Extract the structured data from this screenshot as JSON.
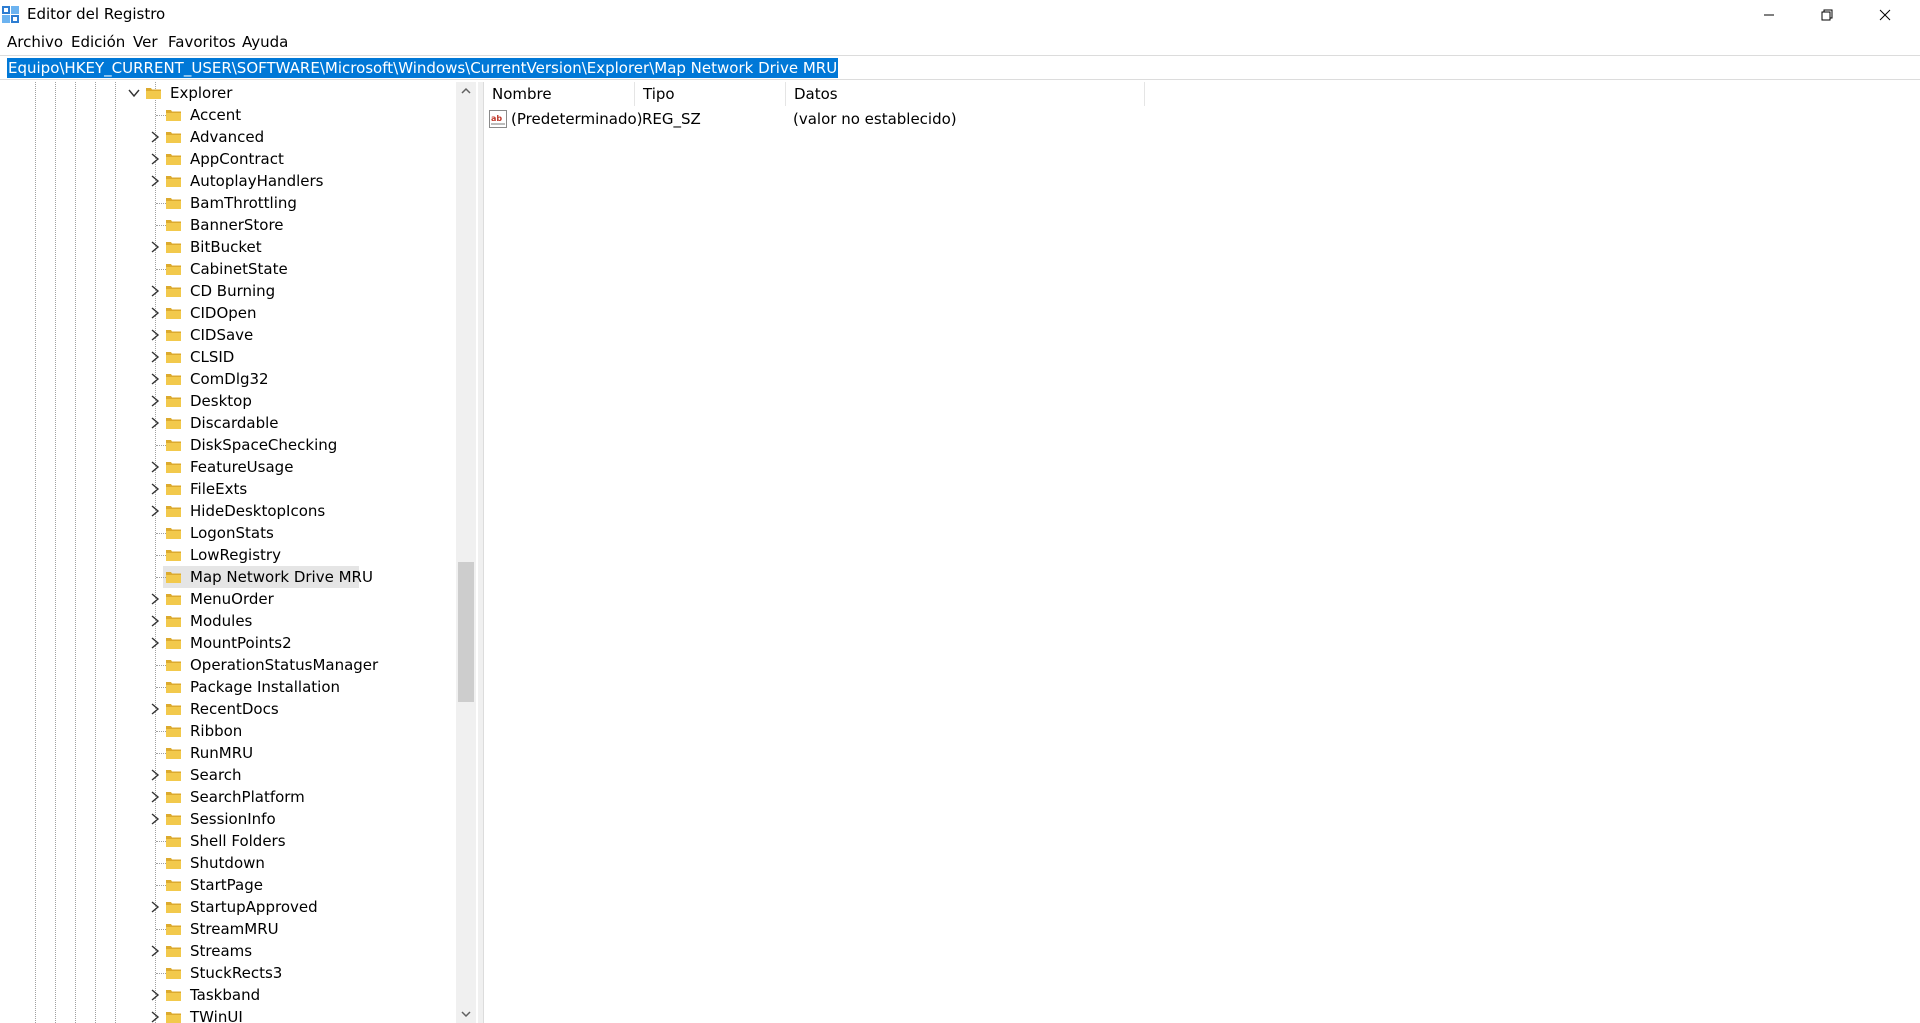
{
  "window": {
    "title": "Editor del Registro",
    "minimize_glyph": "─",
    "maximize_glyph": "❐",
    "close_glyph": "✕"
  },
  "menu": [
    "Archivo",
    "Edición",
    "Ver",
    "Favoritos",
    "Ayuda"
  ],
  "address": {
    "path": "Equipo\\HKEY_CURRENT_USER\\SOFTWARE\\Microsoft\\Windows\\CurrentVersion\\Explorer\\Map Network Drive MRU"
  },
  "tree": {
    "parent": {
      "label": "Explorer",
      "expanded": true
    },
    "children": [
      {
        "label": "Accent",
        "expandable": false
      },
      {
        "label": "Advanced",
        "expandable": true
      },
      {
        "label": "AppContract",
        "expandable": true
      },
      {
        "label": "AutoplayHandlers",
        "expandable": true
      },
      {
        "label": "BamThrottling",
        "expandable": false
      },
      {
        "label": "BannerStore",
        "expandable": false
      },
      {
        "label": "BitBucket",
        "expandable": true
      },
      {
        "label": "CabinetState",
        "expandable": false
      },
      {
        "label": "CD Burning",
        "expandable": true
      },
      {
        "label": "CIDOpen",
        "expandable": true
      },
      {
        "label": "CIDSave",
        "expandable": true
      },
      {
        "label": "CLSID",
        "expandable": true
      },
      {
        "label": "ComDlg32",
        "expandable": true
      },
      {
        "label": "Desktop",
        "expandable": true
      },
      {
        "label": "Discardable",
        "expandable": true
      },
      {
        "label": "DiskSpaceChecking",
        "expandable": false
      },
      {
        "label": "FeatureUsage",
        "expandable": true
      },
      {
        "label": "FileExts",
        "expandable": true
      },
      {
        "label": "HideDesktopIcons",
        "expandable": true
      },
      {
        "label": "LogonStats",
        "expandable": false
      },
      {
        "label": "LowRegistry",
        "expandable": false
      },
      {
        "label": "Map Network Drive MRU",
        "expandable": false,
        "selected": true
      },
      {
        "label": "MenuOrder",
        "expandable": true
      },
      {
        "label": "Modules",
        "expandable": true
      },
      {
        "label": "MountPoints2",
        "expandable": true
      },
      {
        "label": "OperationStatusManager",
        "expandable": false
      },
      {
        "label": "Package Installation",
        "expandable": false
      },
      {
        "label": "RecentDocs",
        "expandable": true
      },
      {
        "label": "Ribbon",
        "expandable": false
      },
      {
        "label": "RunMRU",
        "expandable": false
      },
      {
        "label": "Search",
        "expandable": true
      },
      {
        "label": "SearchPlatform",
        "expandable": true
      },
      {
        "label": "SessionInfo",
        "expandable": true
      },
      {
        "label": "Shell Folders",
        "expandable": false
      },
      {
        "label": "Shutdown",
        "expandable": false
      },
      {
        "label": "StartPage",
        "expandable": false
      },
      {
        "label": "StartupApproved",
        "expandable": true
      },
      {
        "label": "StreamMRU",
        "expandable": false
      },
      {
        "label": "Streams",
        "expandable": true
      },
      {
        "label": "StuckRects3",
        "expandable": false
      },
      {
        "label": "Taskband",
        "expandable": true
      },
      {
        "label": "TWinUI",
        "expandable": true
      }
    ]
  },
  "list": {
    "columns": {
      "name": "Nombre",
      "type": "Tipo",
      "data": "Datos"
    },
    "rows": [
      {
        "name": "(Predeterminado)",
        "type": "REG_SZ",
        "data": "(valor no establecido)",
        "icon": "ab-string-icon"
      }
    ]
  },
  "colors": {
    "selection": "#0078d7",
    "folder": "#f2c94c",
    "folder_dark": "#dcaa2e",
    "tree_selected": "#e5e5e5"
  }
}
